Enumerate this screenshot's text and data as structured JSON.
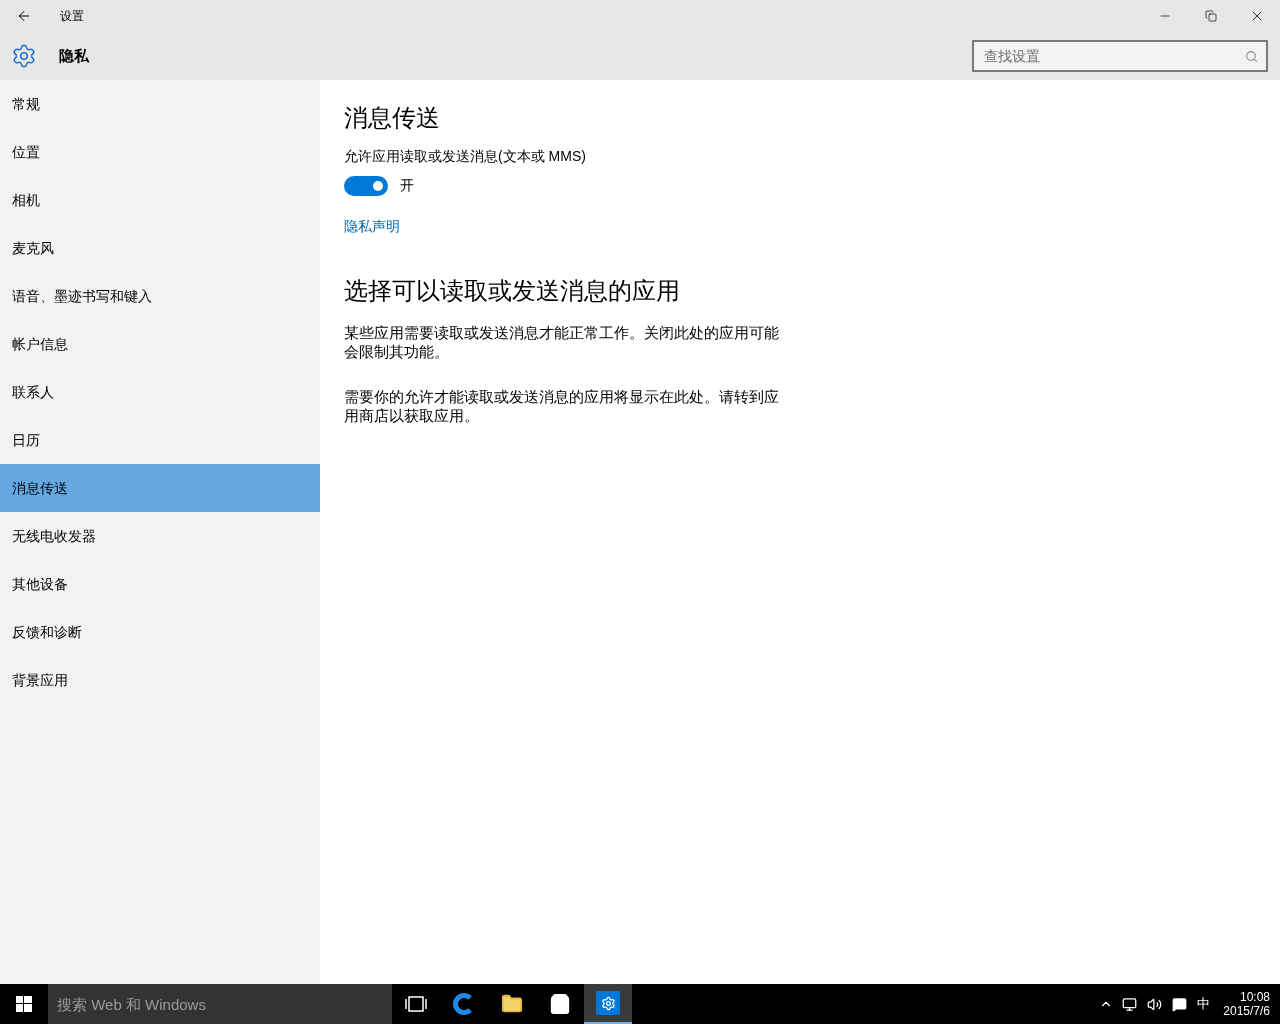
{
  "window": {
    "title": "设置"
  },
  "header": {
    "title": "隐私",
    "search": {
      "placeholder": "查找设置"
    }
  },
  "sidebar": {
    "items": [
      {
        "label": "常规",
        "selected": false
      },
      {
        "label": "位置",
        "selected": false
      },
      {
        "label": "相机",
        "selected": false
      },
      {
        "label": "麦克风",
        "selected": false
      },
      {
        "label": "语音、墨迹书写和键入",
        "selected": false
      },
      {
        "label": "帐户信息",
        "selected": false
      },
      {
        "label": "联系人",
        "selected": false
      },
      {
        "label": "日历",
        "selected": false
      },
      {
        "label": "消息传送",
        "selected": true
      },
      {
        "label": "无线电收发器",
        "selected": false
      },
      {
        "label": "其他设备",
        "selected": false
      },
      {
        "label": "反馈和诊断",
        "selected": false
      },
      {
        "label": "背景应用",
        "selected": false
      }
    ]
  },
  "content": {
    "title": "消息传送",
    "setting": {
      "label": "允许应用读取或发送消息(文本或 MMS)",
      "on": true,
      "state_text": "开"
    },
    "link": "隐私声明",
    "section_title": "选择可以读取或发送消息的应用",
    "paragraphs": [
      "某些应用需要读取或发送消息才能正常工作。关闭此处的应用可能会限制其功能。",
      "需要你的允许才能读取或发送消息的应用将显示在此处。请转到应用商店以获取应用。"
    ]
  },
  "taskbar": {
    "search": {
      "placeholder": "搜索 Web 和 Windows"
    },
    "ime": "中",
    "time": "10:08",
    "date": "2015/7/6"
  }
}
